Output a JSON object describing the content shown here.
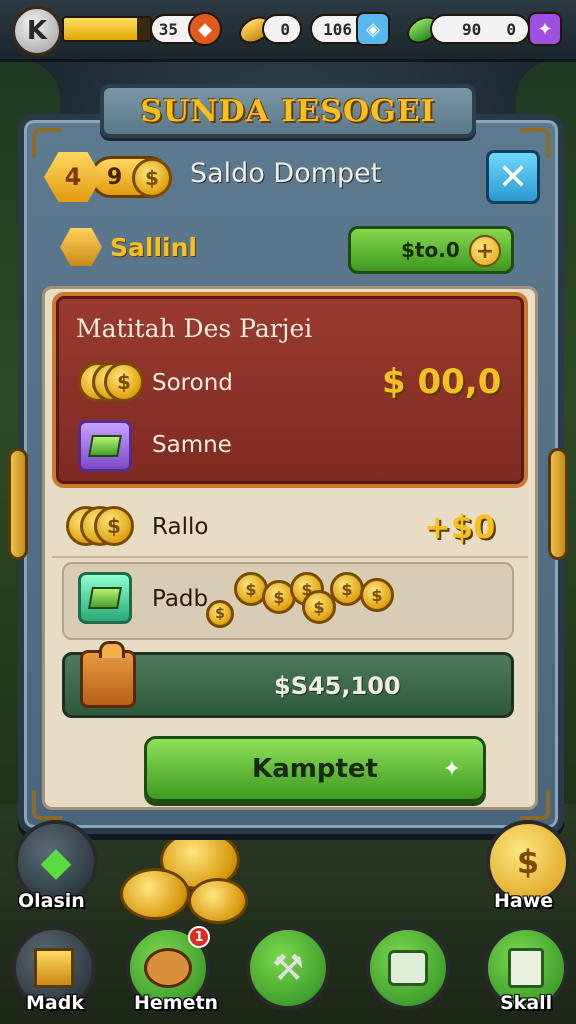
{
  "top_bar": {
    "avatar_letter": "K",
    "xp_progress": 0.85,
    "resources": [
      {
        "name": "gems",
        "value": "35",
        "icon": "red-gem-icon",
        "color": "#e05a20"
      },
      {
        "name": "beans",
        "value": "0",
        "icon": "gold-bean-icon",
        "color": "#e0a410"
      },
      {
        "name": "crystals",
        "value": "106",
        "icon": "blue-crystal-icon",
        "color": "#5ab8f0"
      },
      {
        "name": "leaves",
        "value": "90",
        "icon": "green-leaf-icon",
        "color": "#4ab83a"
      },
      {
        "name": "leaves_count",
        "value": "0",
        "icon": "purple-gem-icon",
        "color": "#a050e0"
      }
    ]
  },
  "modal": {
    "banner_title": "SUNDA IESOGEI",
    "header": {
      "badge_left": "4",
      "badge_mid": "9",
      "title": "Saldo Dompet",
      "close_icon": "close-x-icon"
    },
    "section_label": "Sallinl",
    "add_button_label": "$to.0",
    "red_card": {
      "title": "Matitah Des Parjei",
      "rows": [
        {
          "label": "Sorond",
          "value": "$ 00,0"
        },
        {
          "label": "Samne",
          "value": ""
        }
      ]
    },
    "rows": [
      {
        "label": "Rallo",
        "value": "+$0"
      },
      {
        "label": "Padb",
        "value": ""
      }
    ],
    "total_value": "$S45,100",
    "cta_label": "Kamptet"
  },
  "bottom_nav": [
    {
      "label": "Olasin",
      "icon": "green-gem-icon"
    },
    {
      "label": "Madk",
      "icon": "chest-icon"
    },
    {
      "label": "Hemetn",
      "icon": "character-icon",
      "badge": "1"
    },
    {
      "label": "",
      "icon": "tool-icon"
    },
    {
      "label": "",
      "icon": "green-square-icon"
    },
    {
      "label": "Skall",
      "icon": "scroll-icon"
    },
    {
      "label": "Hawe",
      "icon": "gold-coin-icon"
    }
  ],
  "colors": {
    "accent_gold": "#f6c020",
    "primary_green": "#3e9a20",
    "card_red": "#8a3328",
    "close_blue": "#2a9ad0"
  }
}
